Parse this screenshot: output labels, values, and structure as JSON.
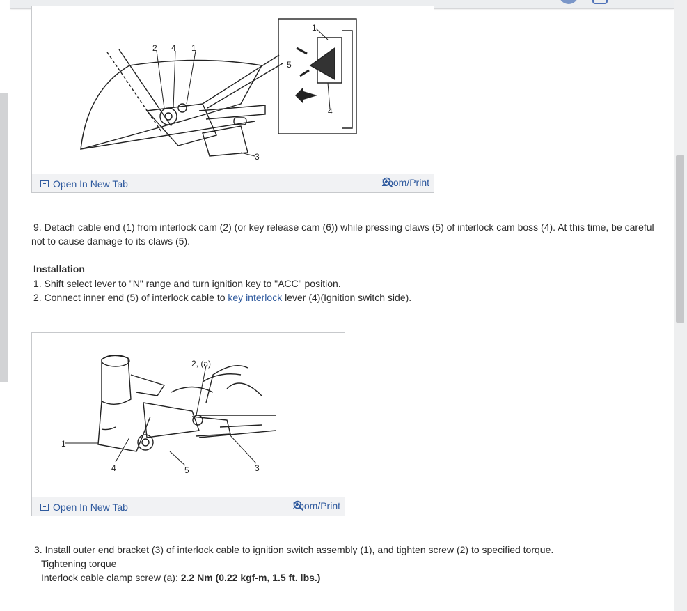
{
  "figure1": {
    "open_tab_label": "Open In New Tab",
    "zoom_label": "Zoom/Print",
    "callouts": [
      "1",
      "2",
      "3",
      "4",
      "5"
    ]
  },
  "step9": "9. Detach cable end (1) from interlock cam (2) (or key release cam (6)) while pressing claws (5) of interlock cam boss (4). At this time, be careful not to cause damage to its claws (5).",
  "installation": {
    "heading": "Installation",
    "step1": "1. Shift select lever to \"N\" range and turn ignition key to \"ACC\" position.",
    "step2_pre": "2. Connect inner end (5) of interlock cable to ",
    "step2_link": "key interlock",
    "step2_post": " lever (4)(Ignition switch side)."
  },
  "figure2": {
    "open_tab_label": "Open In New Tab",
    "zoom_label": "Zoom/Print",
    "callouts": [
      "1",
      "2, (a)",
      "3",
      "4",
      "5"
    ]
  },
  "step3": {
    "text": "3. Install outer end bracket (3) of interlock cable to ignition switch assembly (1), and tighten screw (2) to specified torque.",
    "torque_label": "Tightening torque",
    "spec_label": "Interlock cable clamp screw (a): ",
    "spec_value": "2.2 Nm (0.22 kgf-m, 1.5 ft. lbs.)"
  }
}
